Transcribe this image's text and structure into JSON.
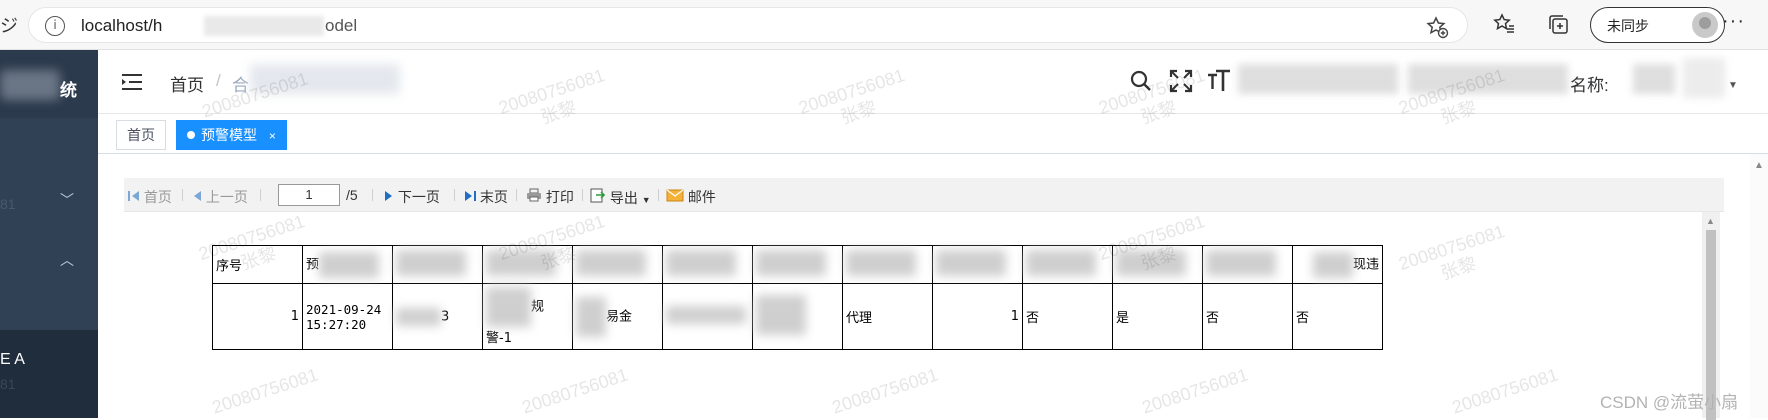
{
  "browser": {
    "left_glyph": "ジ",
    "url_prefix": "localhost/h",
    "url_suffix": "odel",
    "profile_label": "未同步",
    "more": "···"
  },
  "sidebar": {
    "brand": "统",
    "active_item": "E A"
  },
  "header": {
    "breadcrumb_home": "首页",
    "breadcrumb_sep": "/",
    "breadcrumb_current": "合",
    "name_label": "名称:"
  },
  "tags": {
    "home": "首页",
    "active": "预警模型",
    "close": "×"
  },
  "report_toolbar": {
    "first": "首页",
    "prev": "上一页",
    "page_value": "1",
    "page_total": "/5",
    "next": "下一页",
    "last": "末页",
    "print": "打印",
    "export": "导出",
    "mail": "邮件"
  },
  "table": {
    "header_first": "序号",
    "header_second": "预",
    "header_last": "现违",
    "row": {
      "index": "1",
      "time": "2021-09-24 15:27:20",
      "c3": "3",
      "c4": "规",
      "c4b": "警-1",
      "c5": "易金",
      "c8": "代理",
      "c9": "1",
      "c10": "否",
      "c11": "是",
      "c12": "否",
      "c13": "否"
    }
  },
  "watermark": {
    "id": "20080756081",
    "name": "张黎"
  },
  "credit": "CSDN @流萤小扇"
}
